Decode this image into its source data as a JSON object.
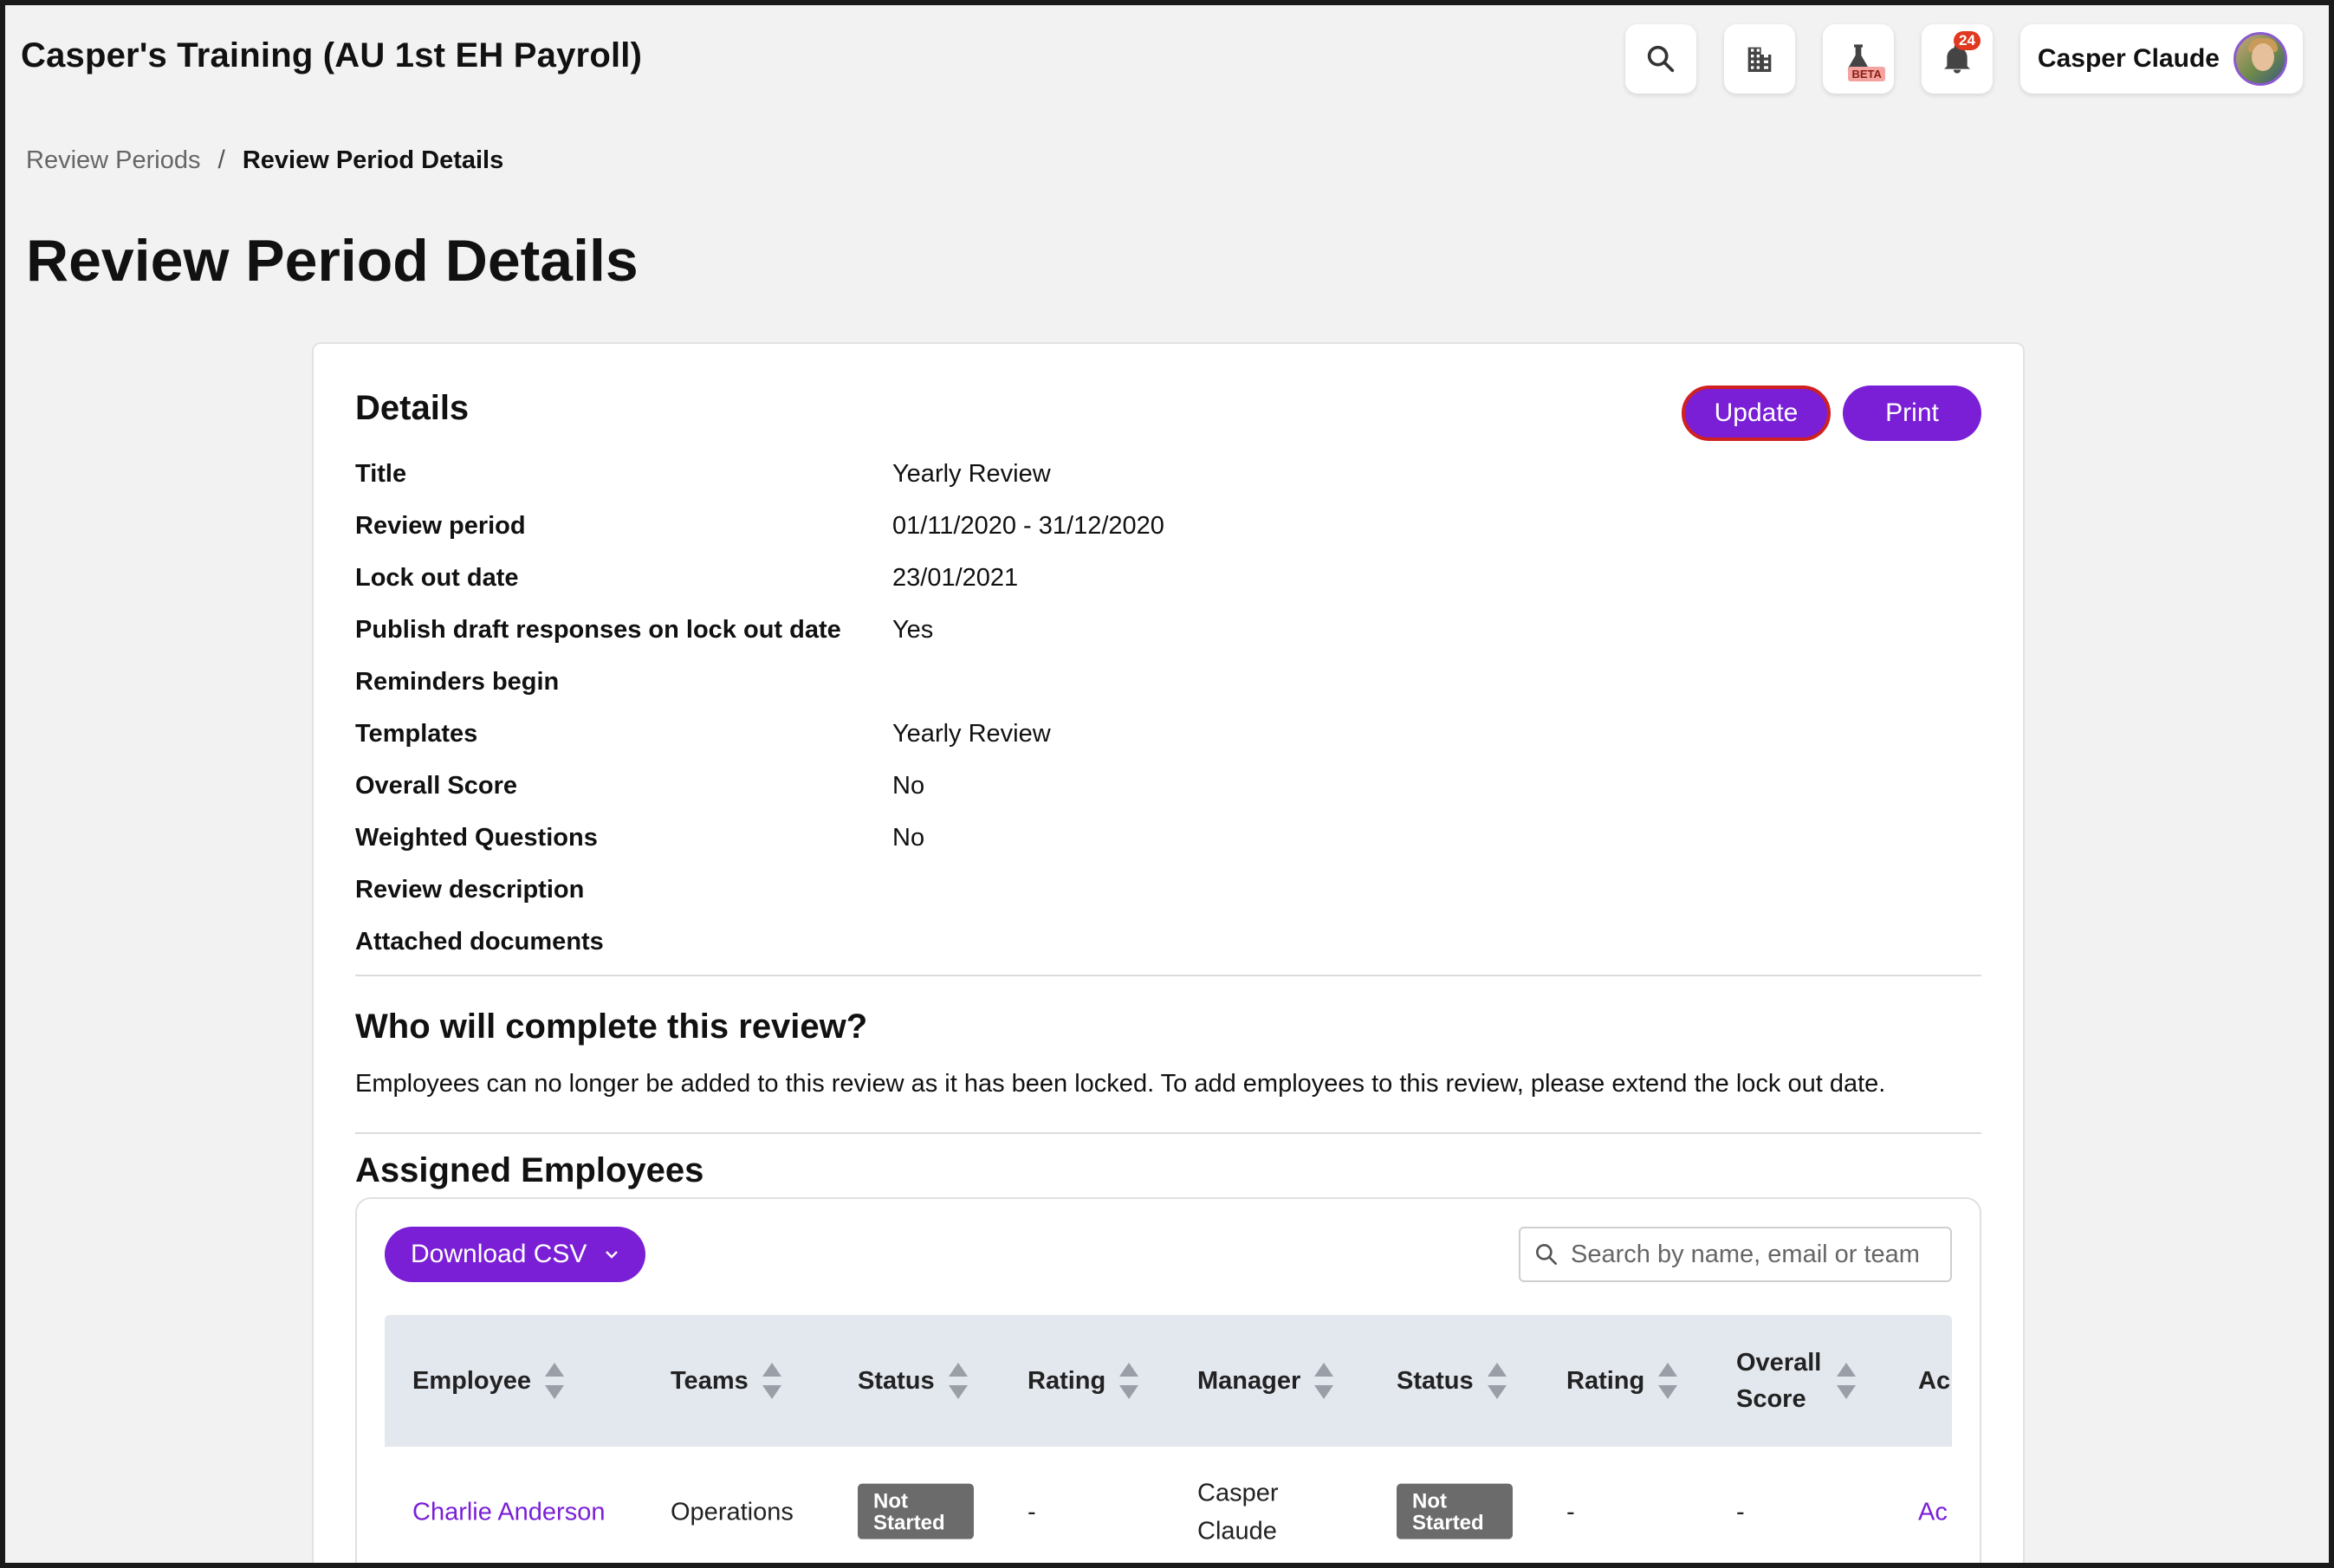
{
  "app": {
    "title": "Casper's Training (AU 1st EH Payroll)"
  },
  "topbar": {
    "beta_label": "BETA",
    "notification_count": "24",
    "user_name": "Casper Claude"
  },
  "breadcrumb": {
    "parent": "Review Periods",
    "separator": "/",
    "current": "Review Period Details"
  },
  "page": {
    "title": "Review Period Details"
  },
  "details": {
    "heading": "Details",
    "update_label": "Update",
    "print_label": "Print",
    "rows": [
      {
        "label": "Title",
        "value": "Yearly Review"
      },
      {
        "label": "Review period",
        "value": "01/11/2020 - 31/12/2020"
      },
      {
        "label": "Lock out date",
        "value": "23/01/2021"
      },
      {
        "label": "Publish draft responses on lock out date",
        "value": "Yes"
      },
      {
        "label": "Reminders begin",
        "value": ""
      },
      {
        "label": "Templates",
        "value": "Yearly Review"
      },
      {
        "label": "Overall Score",
        "value": "No"
      },
      {
        "label": "Weighted Questions",
        "value": "No"
      },
      {
        "label": "Review description",
        "value": ""
      },
      {
        "label": "Attached documents",
        "value": ""
      }
    ]
  },
  "who": {
    "heading": "Who will complete this review?",
    "message": "Employees can no longer be added to this review as it has been locked. To add employees to this review, please extend the lock out date."
  },
  "assigned": {
    "heading": "Assigned Employees",
    "download_label": "Download CSV",
    "search_placeholder": "Search by name, email or team",
    "columns": [
      "Employee",
      "Teams",
      "Status",
      "Rating",
      "Manager",
      "Status",
      "Rating",
      "Overall Score",
      "Ac"
    ],
    "rows": [
      {
        "employee": "Charlie Anderson",
        "teams": "Operations",
        "status": "Not Started",
        "rating": "-",
        "manager": "Casper Claude",
        "manager_status": "Not Started",
        "manager_rating": "-",
        "overall_score": "-",
        "action": "Ac"
      }
    ]
  },
  "colors": {
    "accent": "#7a1fd6",
    "focus_ring": "#d02020",
    "badge": "#6b6b6b",
    "table_header": "#e3e7ee",
    "background": "#f2f2f3"
  }
}
